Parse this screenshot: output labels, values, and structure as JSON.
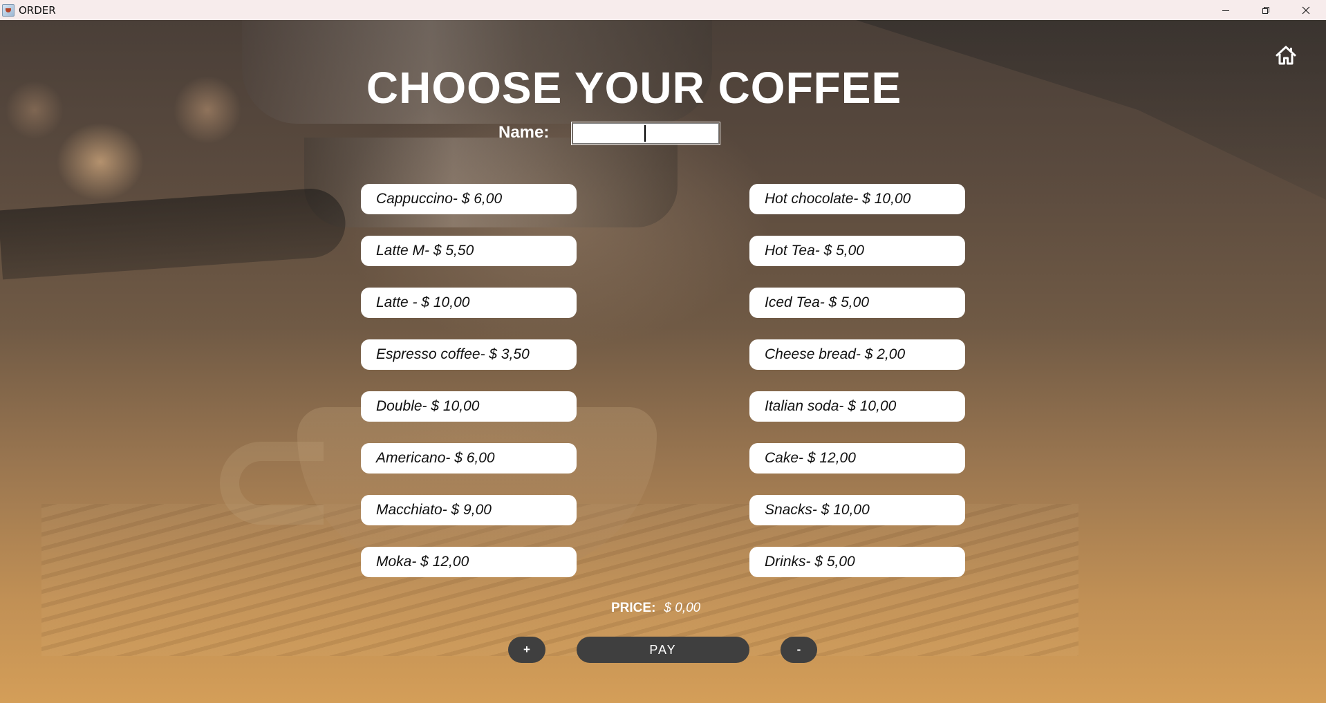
{
  "window": {
    "title": "ORDER",
    "controls": [
      "minimize-icon",
      "restore-icon",
      "close-icon"
    ]
  },
  "header": {
    "title": "CHOOSE YOUR COFFEE",
    "home_icon": "home-icon"
  },
  "form": {
    "name_label": "Name:",
    "name_value": "",
    "name_placeholder": ""
  },
  "menu": {
    "left": [
      {
        "label": "Cappuccino- $ 6,00"
      },
      {
        "label": "Latte M- $ 5,50"
      },
      {
        "label": "Latte - $ 10,00"
      },
      {
        "label": "Espresso coffee- $ 3,50"
      },
      {
        "label": "Double- $ 10,00"
      },
      {
        "label": "Americano- $ 6,00"
      },
      {
        "label": "Macchiato- $ 9,00"
      },
      {
        "label": "Moka- $ 12,00"
      }
    ],
    "right": [
      {
        "label": "Hot chocolate- $ 10,00"
      },
      {
        "label": "Hot Tea- $ 5,00"
      },
      {
        "label": "Iced Tea- $ 5,00"
      },
      {
        "label": "Cheese bread- $ 2,00"
      },
      {
        "label": "Italian soda- $ 10,00"
      },
      {
        "label": "Cake- $ 12,00"
      },
      {
        "label": "Snacks- $ 10,00"
      },
      {
        "label": "Drinks- $ 5,00"
      }
    ]
  },
  "summary": {
    "price_label": "PRICE:",
    "price_value": "$ 0,00"
  },
  "actions": {
    "plus_label": "+",
    "pay_label": "PAY",
    "minus_label": "-"
  },
  "colors": {
    "titlebar": "#f7ecec",
    "button_bg": "#ffffff",
    "control_bg": "#3f3f3f",
    "text_light": "#ffffff"
  }
}
